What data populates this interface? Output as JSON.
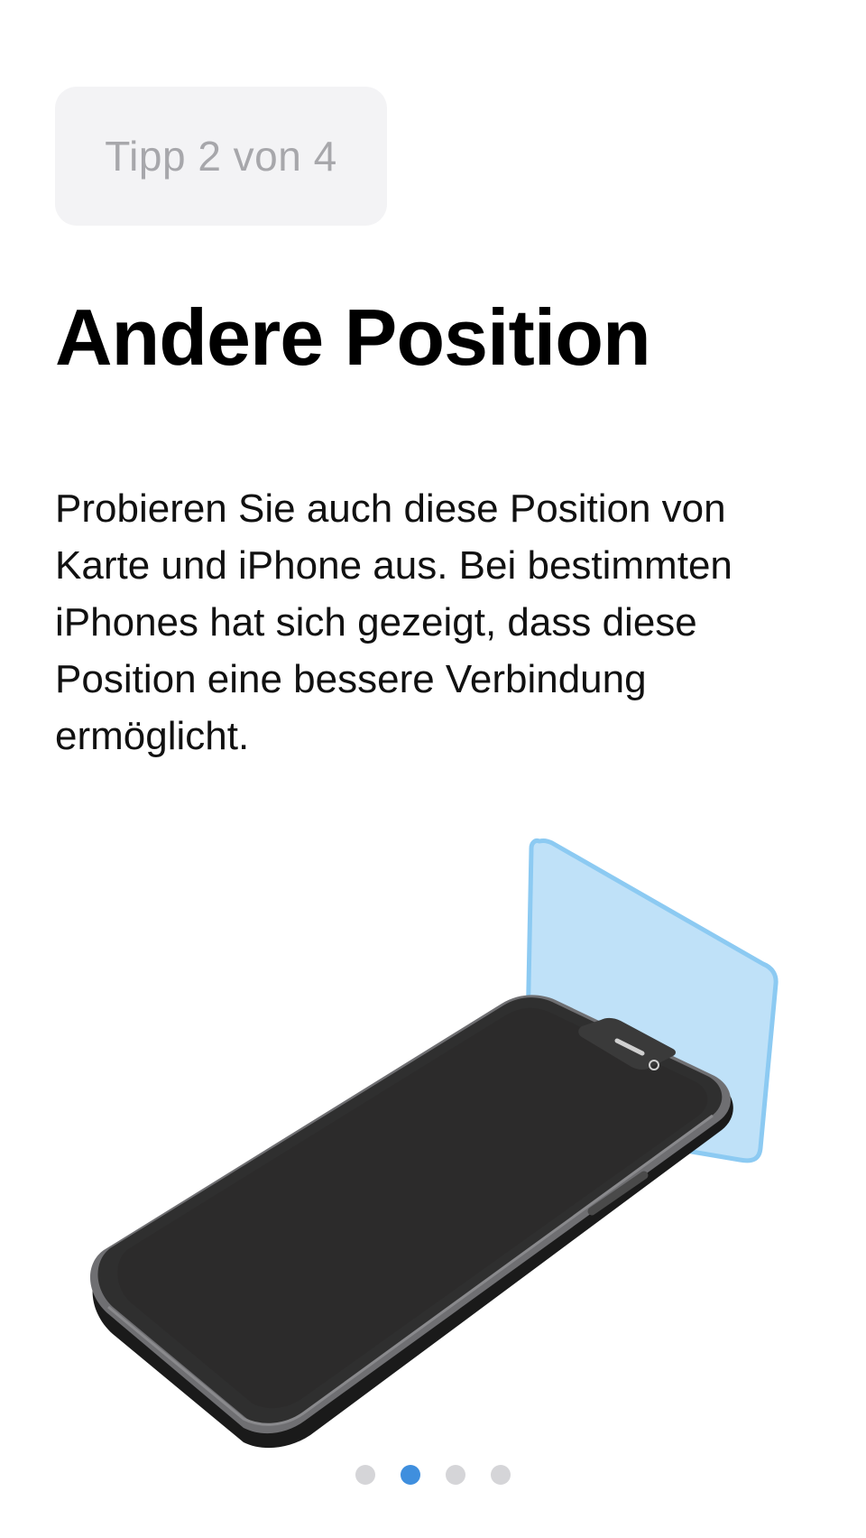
{
  "tip": {
    "label": "Tipp 2 von 4"
  },
  "title": "Andere Position",
  "description": "Probieren Sie auch diese Position von Karte und iPhone aus. Bei bestimmten iPhones hat sich gezeigt, dass diese Position eine bessere Verbindung ermöglicht.",
  "illustration": {
    "card_color": "#bfe1f8",
    "card_edge_color": "#8ccaf2",
    "phone_body_color": "#2f2f2f",
    "phone_screen_color": "#2c2b2b"
  },
  "pager": {
    "total": 4,
    "current_index": 1,
    "active_color": "#3f8fde",
    "inactive_color": "#d5d5d8"
  }
}
